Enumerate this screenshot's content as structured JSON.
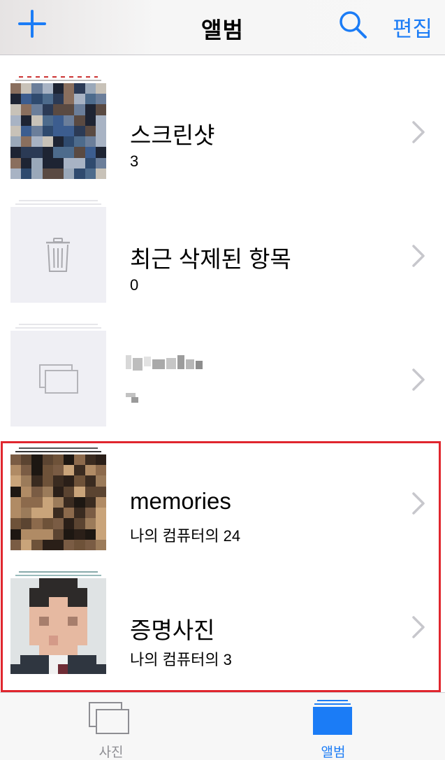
{
  "header": {
    "title": "앨범",
    "add_icon": "plus-icon",
    "search_icon": "search-icon",
    "edit_label": "편집",
    "accent_color": "#1b7cf6"
  },
  "albums": [
    {
      "title": "스크린샷",
      "count": "3",
      "thumb": "photo-mosaic"
    },
    {
      "title": "최근 삭제된 항목",
      "count": "0",
      "thumb": "trash-icon"
    },
    {
      "title": "",
      "count": "",
      "thumb": "album-placeholder-icon"
    },
    {
      "title": "memories",
      "count": "나의 컴퓨터의 24",
      "thumb": "photo-mosaic"
    },
    {
      "title": "증명사진",
      "count": "나의 컴퓨터의 3",
      "thumb": "portrait-photo"
    }
  ],
  "tabbar": {
    "tabs": [
      {
        "label": "사진",
        "icon": "photos-tab-icon",
        "active": false
      },
      {
        "label": "앨범",
        "icon": "albums-tab-icon",
        "active": true
      }
    ]
  },
  "highlight_color": "#e0262e"
}
